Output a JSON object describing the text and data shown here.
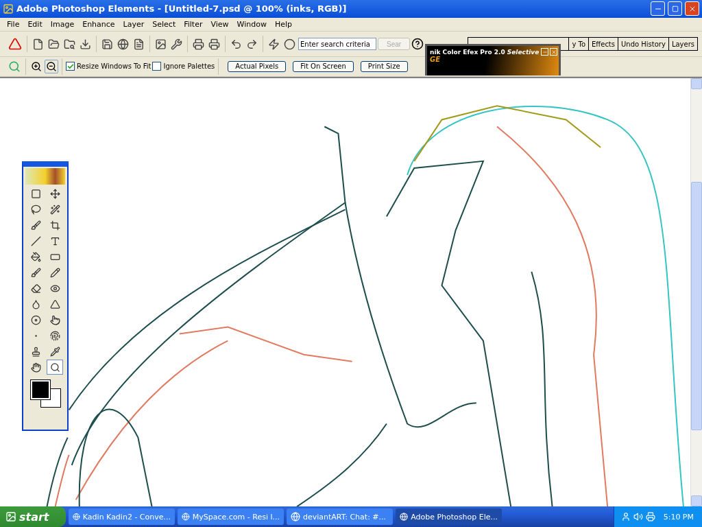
{
  "window": {
    "title": "Adobe Photoshop Elements - [Untitled-7.psd @ 100% (inks, RGB)]"
  },
  "menu": [
    "File",
    "Edit",
    "Image",
    "Enhance",
    "Layer",
    "Select",
    "Filter",
    "View",
    "Window",
    "Help"
  ],
  "search": {
    "placeholder": "Enter search criteria",
    "button": "Sear"
  },
  "palette_tabs": [
    {
      "label": "y To",
      "selected": false
    },
    {
      "label": "Effects",
      "selected": false
    },
    {
      "label": "Undo History",
      "selected": false
    },
    {
      "label": "Layers",
      "selected": false
    }
  ],
  "options": {
    "checkboxes": [
      {
        "label": "Resize Windows To Fit",
        "checked": true
      },
      {
        "label": "Ignore Palettes",
        "checked": false
      }
    ],
    "buttons": [
      "Actual Pixels",
      "Fit On Screen",
      "Print Size"
    ]
  },
  "plugin_window": {
    "title": "nik Color Efex Pro 2.0",
    "title_italic": "Selective",
    "subtitle": "GE"
  },
  "tools": [
    {
      "selected": false
    },
    {
      "selected": false
    },
    {
      "selected": false
    },
    {
      "selected": false
    },
    {
      "selected": false
    },
    {
      "selected": false
    },
    {
      "selected": false
    },
    {
      "selected": false
    },
    {
      "selected": false
    },
    {
      "selected": false
    },
    {
      "selected": false
    },
    {
      "selected": false
    },
    {
      "selected": false
    },
    {
      "selected": false
    },
    {
      "selected": false
    },
    {
      "selected": false
    },
    {
      "selected": false
    },
    {
      "selected": false
    },
    {
      "selected": false
    },
    {
      "selected": false
    },
    {
      "selected": false
    },
    {
      "selected": false
    },
    {
      "selected": false
    },
    {
      "selected": true
    }
  ],
  "taskbar": {
    "start": "start",
    "tasks": [
      {
        "label": "Kadin Kadin2 - Conve...",
        "selected": false
      },
      {
        "label": "MySpace.com - Resi l...",
        "selected": false
      },
      {
        "label": "deviantART: Chat: #...",
        "selected": false
      },
      {
        "label": "Adobe Photoshop Ele...",
        "selected": true
      }
    ],
    "time": "5:10 PM"
  }
}
